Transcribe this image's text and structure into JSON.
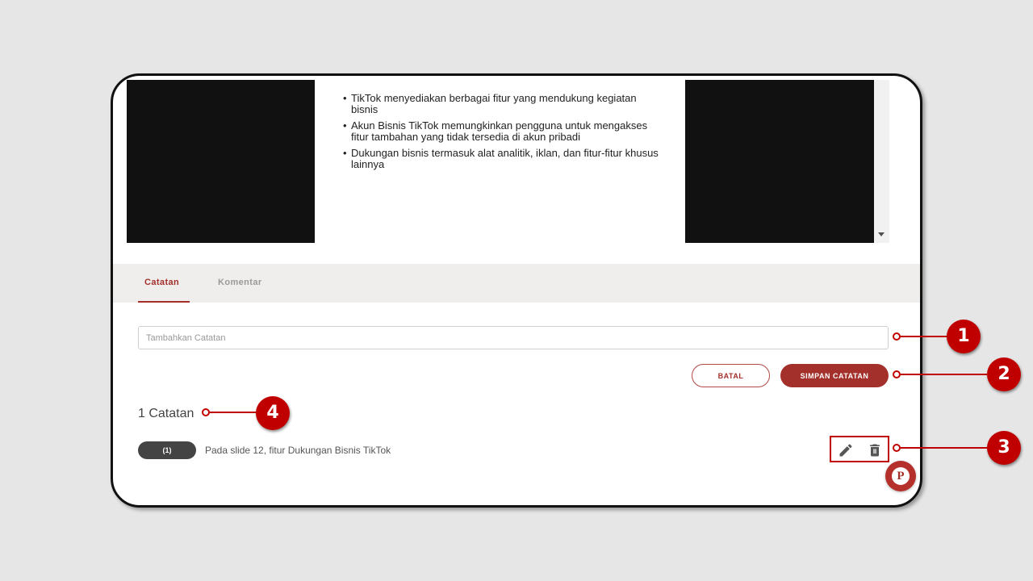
{
  "slide": {
    "bullets": [
      "TikTok menyediakan berbagai fitur yang mendukung kegiatan bisnis",
      "Akun Bisnis TikTok memungkinkan pengguna untuk mengakses fitur tambahan yang tidak tersedia di akun pribadi",
      "Dukungan bisnis termasuk alat analitik, iklan, dan fitur-fitur khusus lainnya"
    ]
  },
  "tabs": [
    {
      "label": "Catatan",
      "active": true
    },
    {
      "label": "Komentar",
      "active": false
    }
  ],
  "note_form": {
    "placeholder": "Tambahkan Catatan",
    "value": "",
    "cancel_label": "BATAL",
    "save_label": "SIMPAN CATATAN"
  },
  "notes_summary": {
    "count_label": "1 Catatan"
  },
  "notes": [
    {
      "slide_label": "(1)",
      "text": "Pada slide 12, fitur Dukungan Bisnis TikTok"
    }
  ],
  "note_actions": {
    "edit_icon": "pencil-icon",
    "delete_icon": "trash-icon"
  },
  "fab": {
    "letter": "P"
  },
  "callouts": [
    "1",
    "2",
    "3",
    "4"
  ],
  "colors": {
    "accent": "#a3302a",
    "callout": "#c00000",
    "background": "#e6e6e6"
  }
}
